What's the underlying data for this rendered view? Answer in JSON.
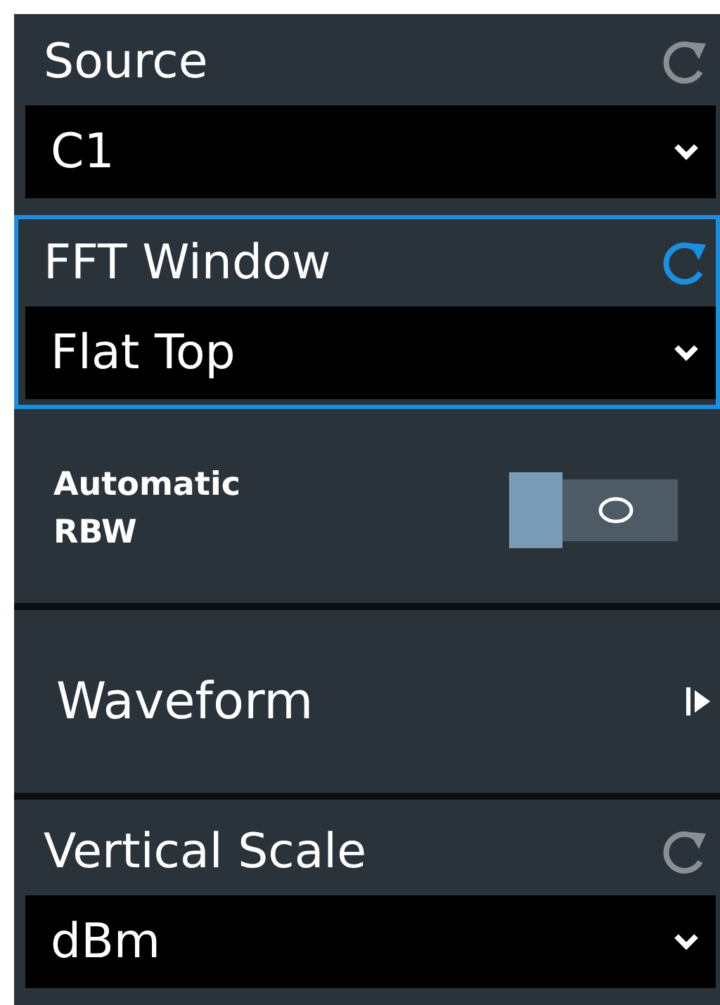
{
  "items": [
    {
      "kind": "dropdown",
      "label": "Source",
      "value": "C1",
      "focused": false
    },
    {
      "kind": "dropdown",
      "label": "FFT Window",
      "value": "Flat Top",
      "focused": true
    },
    {
      "kind": "toggle",
      "label": "Automatic RBW",
      "on": false
    },
    {
      "kind": "submenu",
      "label": "Waveform"
    },
    {
      "kind": "dropdown",
      "label": "Vertical Scale",
      "value": "dBm",
      "focused": false
    }
  ]
}
